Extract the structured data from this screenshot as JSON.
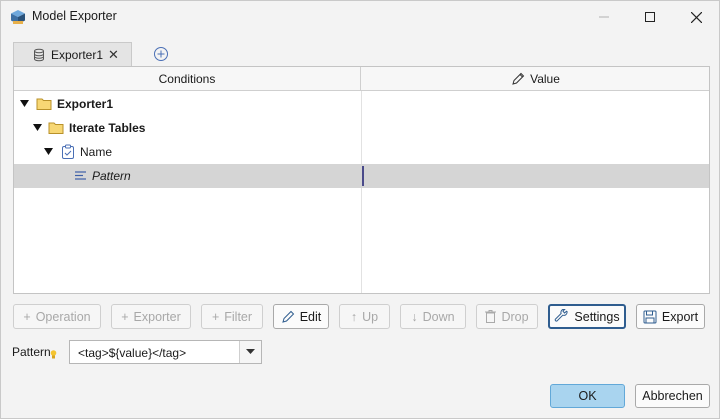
{
  "window": {
    "title": "Model Exporter",
    "app_icon": "cube-app-icon"
  },
  "tabs": [
    {
      "label": "Exporter1",
      "icon": "database-icon",
      "active": true
    }
  ],
  "tree": {
    "columns": {
      "conditions": "Conditions",
      "value": "Value"
    },
    "rows": [
      {
        "label": "Exporter1",
        "icon": "folder-icon",
        "expanded": true,
        "bold": true
      },
      {
        "label": "Iterate Tables",
        "icon": "folder-icon",
        "expanded": true,
        "bold": true
      },
      {
        "label": "Name",
        "icon": "clipboard-icon",
        "expanded": true,
        "bold": false
      },
      {
        "label": "Pattern",
        "icon": "text-lines-icon",
        "selected": true,
        "italic": true,
        "value": ""
      }
    ]
  },
  "toolbar": {
    "operation": "Operation",
    "exporter": "Exporter",
    "filter": "Filter",
    "edit": "Edit",
    "up": "Up",
    "down": "Down",
    "drop": "Drop",
    "settings": "Settings",
    "export": "Export"
  },
  "pattern": {
    "label": "Pattern",
    "value": "<tag>${value}</tag>"
  },
  "dialog": {
    "ok": "OK",
    "cancel": "Abbrechen"
  },
  "colors": {
    "selection": "#d5d5d5",
    "folder": "#f2c94c",
    "ok_button": "#a9d4ef",
    "focus_border": "#2f5d8f"
  }
}
